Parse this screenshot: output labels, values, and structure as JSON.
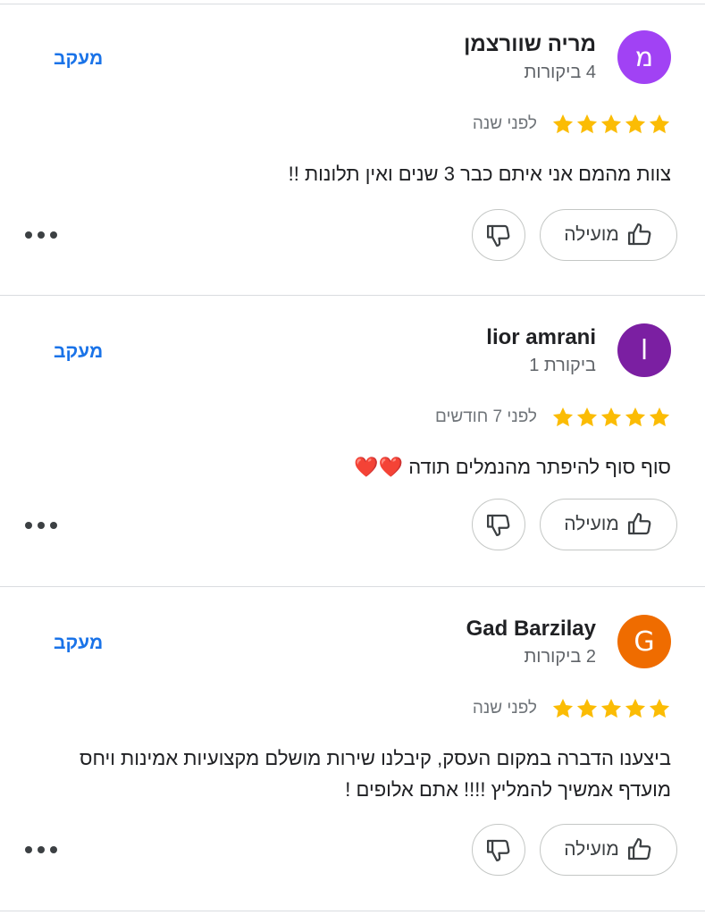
{
  "reviews": [
    {
      "avatar_letter": "מ",
      "avatar_color": "#a142f4",
      "author": "מריה שוורצמן",
      "review_count": "4 ביקורות",
      "follow_label": "מעקב",
      "rating": 5,
      "date": "לפני שנה",
      "text": "צוות מהמם אני איתם כבר 3 שנים ואין תלונות !!",
      "helpful_label": "מועילה"
    },
    {
      "avatar_letter": "l",
      "avatar_color": "#7b1fa2",
      "author": "lior amrani",
      "review_count": "ביקורת 1",
      "follow_label": "מעקב",
      "rating": 5,
      "date": "לפני 7 חודשים",
      "text": "סוף סוף להיפתר מהנמלים תודה ❤️❤️",
      "helpful_label": "מועילה"
    },
    {
      "avatar_letter": "G",
      "avatar_color": "#ef6c00",
      "author": "Gad Barzilay",
      "review_count": "2 ביקורות",
      "follow_label": "מעקב",
      "rating": 5,
      "date": "לפני שנה",
      "text": "ביצענו הדברה במקום העסק, קיבלנו שירות מושלם מקצועיות אמינות ויחס מועדף אמשיך להמליץ !!!! אתם אלופים !",
      "helpful_label": "מועילה"
    }
  ],
  "icons": {
    "star": "star-icon",
    "helpful": "thumb-up-icon",
    "unhelpful": "thumb-down-icon",
    "more": "more-horizontal-icon"
  },
  "colors": {
    "star": "#fbbc04",
    "follow": "#1a73e8",
    "divider": "#dadce0"
  }
}
